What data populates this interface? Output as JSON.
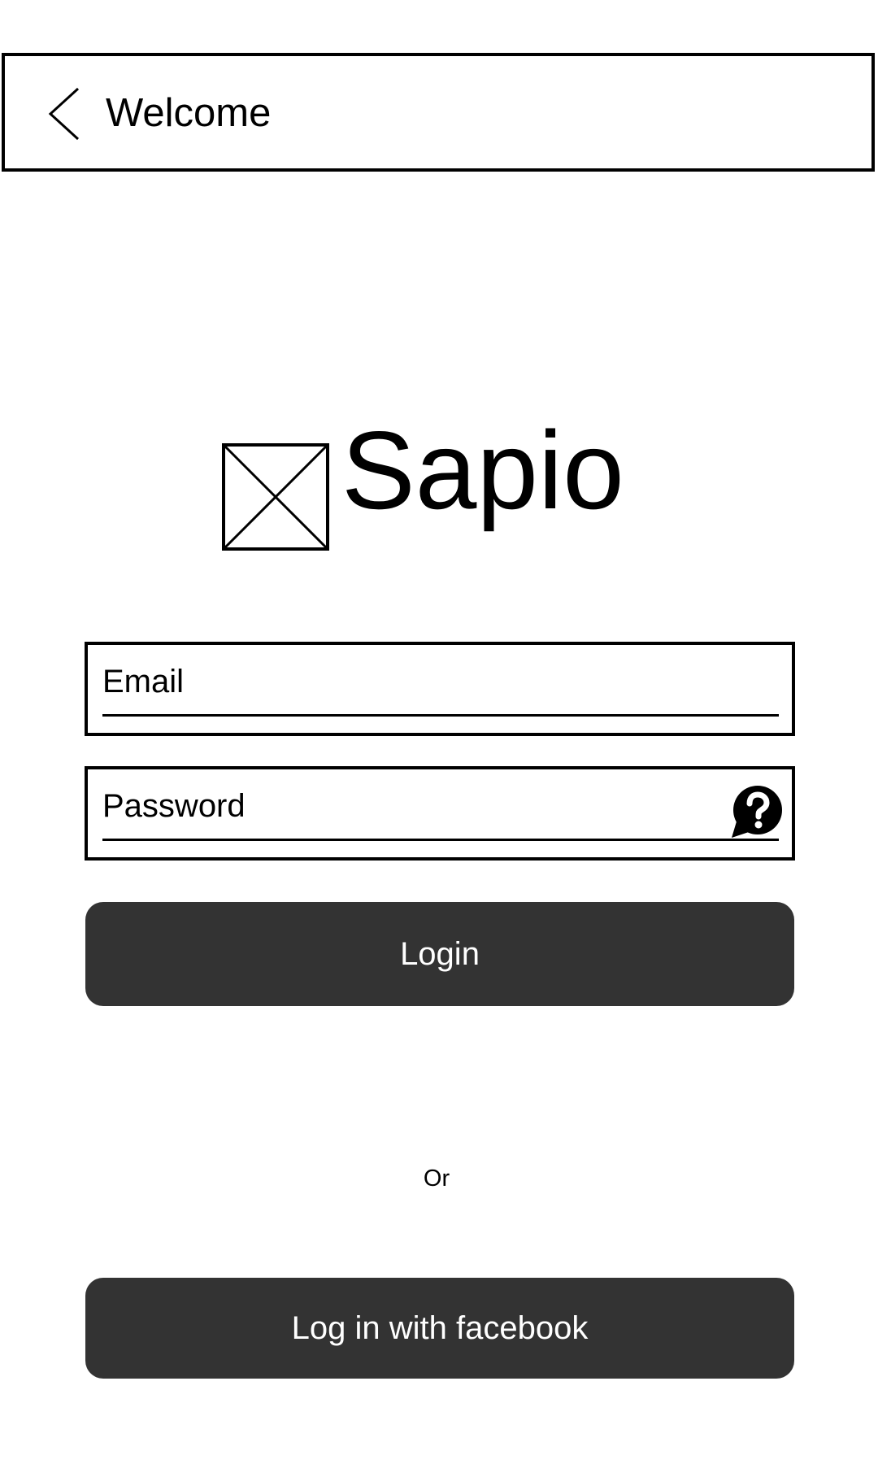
{
  "header": {
    "title": "Welcome",
    "back_icon": "chevron-left-icon"
  },
  "brand": {
    "logo_icon": "image-placeholder-icon",
    "name": "Sapio"
  },
  "form": {
    "email_placeholder": "Email",
    "password_placeholder": "Password",
    "help_icon": "help-bubble-icon",
    "login_label": "Login"
  },
  "divider_text": "Or",
  "facebook_button_label": "Log in with facebook",
  "colors": {
    "button_background": "#333333",
    "button_text": "#ffffff",
    "outline": "#000000",
    "background": "#ffffff"
  }
}
